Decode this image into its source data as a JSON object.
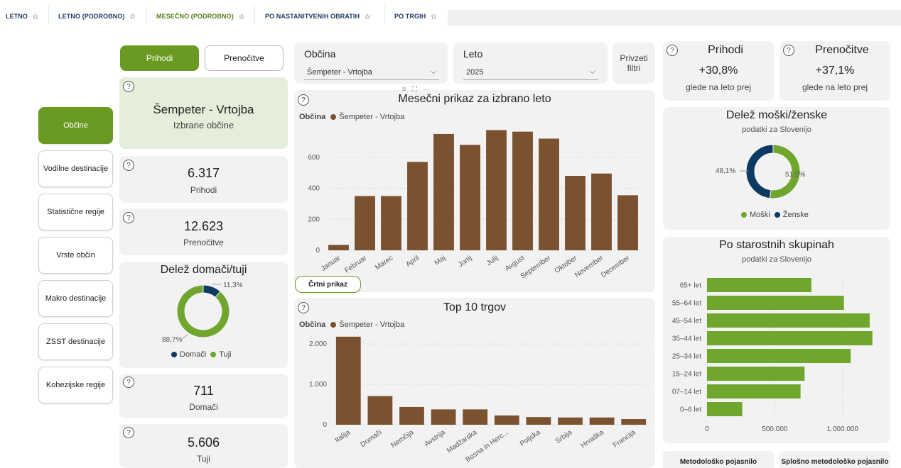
{
  "tabs": [
    {
      "label": "LETNO",
      "active": false
    },
    {
      "label": "LETNO (PODROBNO)",
      "active": false
    },
    {
      "label": "MESEČNO (PODROBNO)",
      "active": true
    },
    {
      "label": "PO NASTANITVENIH OBRATIH",
      "active": false
    },
    {
      "label": "PO TRGIH",
      "active": false
    }
  ],
  "nav": [
    "Občine",
    "Vodilne destinacije",
    "Statistične regije",
    "Vrste občin",
    "Makro destinacije",
    "ZSST destinacije",
    "Kohezijske regije"
  ],
  "toggle": {
    "on": "Prihodi",
    "off": "Prenočitve"
  },
  "selected": {
    "name": "Šempeter - Vrtojba",
    "caption": "Izbrane občine"
  },
  "kpis": {
    "prihodi_value": "6.317",
    "prihodi_label": "Prihodi",
    "prenocitve_value": "12.623",
    "prenocitve_label": "Prenočitve",
    "domaci_value": "711",
    "domaci_label": "Domači",
    "tuji_value": "5.606",
    "tuji_label": "Tuji"
  },
  "slicers": {
    "obcina_title": "Občina",
    "obcina_value": "Šempeter - Vrtojba",
    "leto_title": "Leto",
    "leto_value": "2025",
    "reset_label": "Privzeti filtri"
  },
  "right_kpis": {
    "prihodi_title": "Prihodi",
    "prihodi_value": "+30,8%",
    "prihodi_sub": "glede na leto prej",
    "prenocitve_title": "Prenočitve",
    "prenocitve_value": "+37,1%",
    "prenocitve_sub": "glede na leto prej"
  },
  "line_button": "Črtni prikaz",
  "bottom_buttons": [
    "Metodološko pojasnilo",
    "Splošno metodološko pojasnilo"
  ],
  "colors": {
    "accent": "#6a9a22",
    "bar": "#7b5230",
    "navy": "#0d3a63",
    "green": "#6fa62d"
  },
  "chart_data": [
    {
      "type": "bar",
      "title": "Mesečni prikaz za izbrano leto",
      "legend_title": "Občina",
      "series": [
        {
          "name": "Šempeter - Vrtojba",
          "values": [
            35,
            350,
            350,
            570,
            750,
            680,
            775,
            765,
            720,
            480,
            495,
            355
          ]
        }
      ],
      "categories": [
        "Januar",
        "Februar",
        "Marec",
        "April",
        "Maj",
        "Junij",
        "Julij",
        "Avgust",
        "September",
        "Oktober",
        "November",
        "December"
      ],
      "yticks": [
        "0",
        "200",
        "400",
        "600"
      ],
      "ylim": [
        0,
        800
      ]
    },
    {
      "type": "bar",
      "title": "Top 10 trgov",
      "legend_title": "Občina",
      "series": [
        {
          "name": "Šempeter - Vrtojba",
          "values": [
            2180,
            710,
            440,
            380,
            380,
            230,
            190,
            180,
            180,
            140
          ]
        }
      ],
      "categories": [
        "Italija",
        "Domači",
        "Nemčija",
        "Avstrija",
        "Madžarska",
        "Bosna in Herc...",
        "Poljska",
        "Srbija",
        "Hrvaška",
        "Francija"
      ],
      "yticks": [
        "0",
        "1.000",
        "2.000"
      ],
      "ylim": [
        0,
        2300
      ]
    },
    {
      "type": "pie",
      "title": "Delež domači/tuji",
      "labels": [
        "Domači",
        "Tuji"
      ],
      "values": [
        11.3,
        88.7
      ],
      "value_labels": [
        "11,3%",
        "88,7%"
      ]
    },
    {
      "type": "pie",
      "title": "Delež moški/ženske",
      "subtitle": "podatki za Slovenijo",
      "labels": [
        "Moški",
        "Ženske"
      ],
      "values": [
        51.9,
        48.1
      ],
      "value_labels": [
        "51,9%",
        "48,1%"
      ]
    },
    {
      "type": "bar",
      "orientation": "horizontal",
      "title": "Po starostnih skupinah",
      "subtitle": "podatki za Slovenijo",
      "categories": [
        "65+ let",
        "55–64 let",
        "45–54 let",
        "35–44 let",
        "25–34 let",
        "15–24 let",
        "07–14 let",
        "0–6 let"
      ],
      "values": [
        770000,
        1010000,
        1200000,
        1220000,
        1060000,
        720000,
        690000,
        260000
      ],
      "xticks": [
        "0",
        "500.000",
        "1.000.000"
      ],
      "xlim": [
        0,
        1300000
      ]
    }
  ]
}
